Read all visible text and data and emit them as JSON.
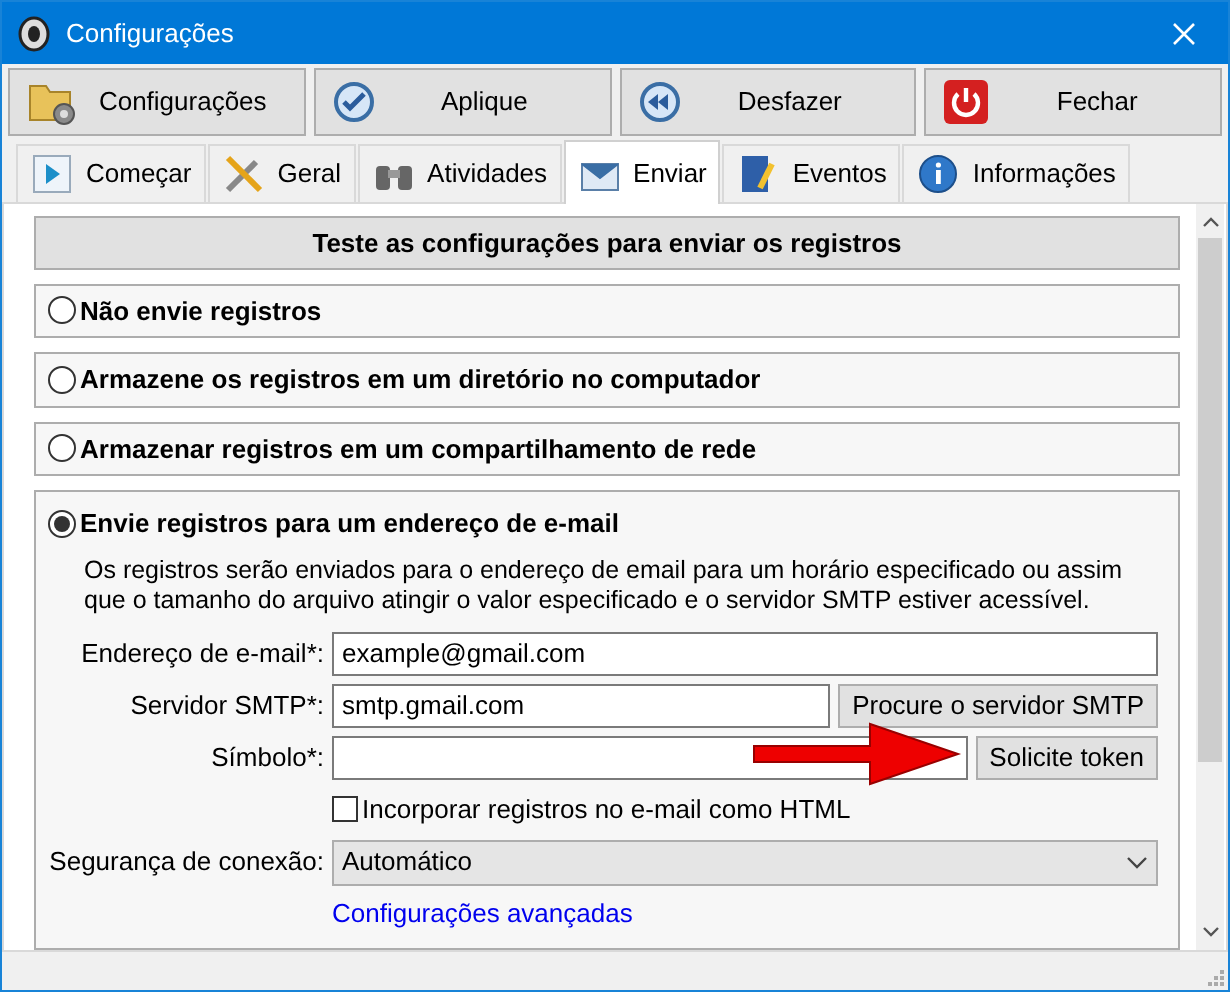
{
  "window": {
    "title": "Configurações"
  },
  "toolbar": [
    {
      "label": "Configurações"
    },
    {
      "label": "Aplique"
    },
    {
      "label": "Desfazer"
    },
    {
      "label": "Fechar"
    }
  ],
  "tabs": [
    {
      "label": "Começar",
      "selected": false
    },
    {
      "label": "Geral",
      "selected": false
    },
    {
      "label": "Atividades",
      "selected": false
    },
    {
      "label": "Enviar",
      "selected": true
    },
    {
      "label": "Eventos",
      "selected": false
    },
    {
      "label": "Informações",
      "selected": false
    }
  ],
  "test_button": "Teste as configurações para enviar os registros",
  "options": [
    {
      "label": "Não envie registros",
      "selected": false
    },
    {
      "label": "Armazene os registros em um diretório no computador",
      "selected": false
    },
    {
      "label": "Armazenar registros em um compartilhamento de rede",
      "selected": false
    },
    {
      "label": "Envie registros para um endereço de e-mail",
      "selected": true
    }
  ],
  "email": {
    "description": "Os registros serão enviados para o endereço de email para um horário especificado ou assim que o tamanho do arquivo atingir o valor especificado e o servidor SMTP estiver acessível.",
    "fields": [
      {
        "label": "Endereço de e-mail*:",
        "value": "example@gmail.com"
      },
      {
        "label": "Servidor SMTP*:",
        "value": "smtp.gmail.com",
        "button": "Procure o servidor SMTP"
      },
      {
        "label": "Símbolo*:",
        "button": "Solicite token"
      }
    ],
    "embed_html": {
      "label": "Incorporar registros no e-mail como HTML",
      "checked": false
    },
    "security": {
      "label": "Segurança de conexão:",
      "value": "Automático"
    },
    "advanced_link": "Configurações avançadas"
  }
}
